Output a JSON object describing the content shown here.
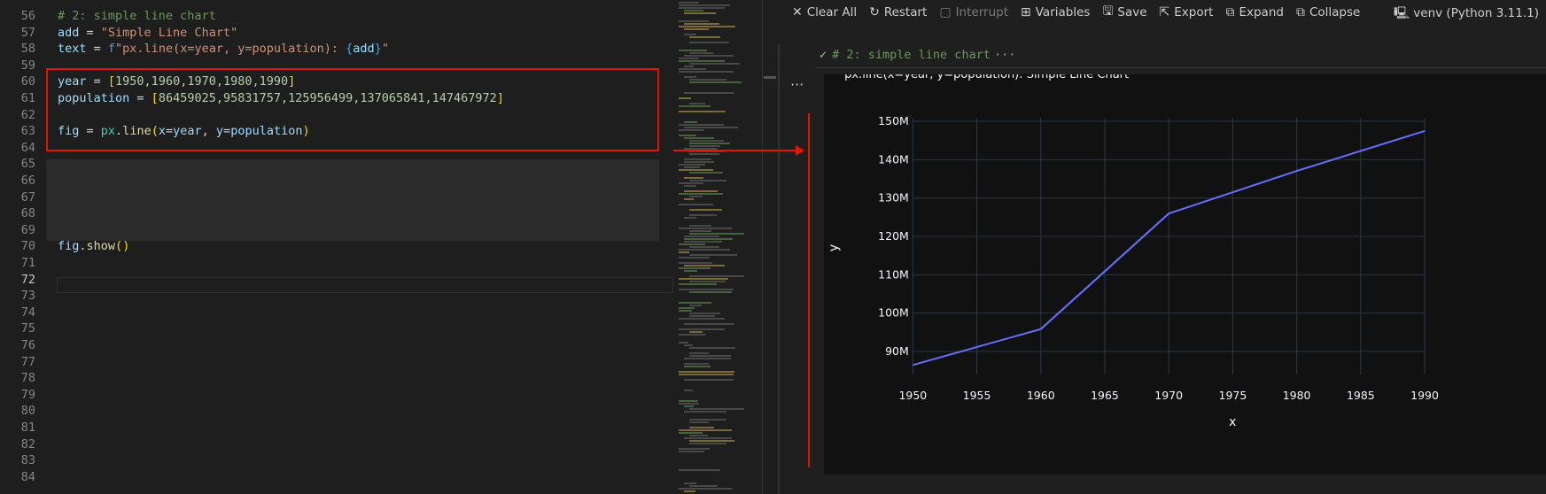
{
  "editor": {
    "lines": [
      {
        "n": "56",
        "tokens": [
          [
            "# 2: simple line chart",
            "comment"
          ]
        ]
      },
      {
        "n": "57",
        "tokens": [
          [
            "add",
            "var"
          ],
          [
            " = ",
            "op"
          ],
          [
            "\"Simple Line Chart\"",
            "str"
          ]
        ]
      },
      {
        "n": "58",
        "tokens": [
          [
            "text",
            "var"
          ],
          [
            " = ",
            "op"
          ],
          [
            "f",
            "kw"
          ],
          [
            "\"px.line(x=year, y=population): ",
            "str"
          ],
          [
            "{",
            "kw"
          ],
          [
            "add",
            "var"
          ],
          [
            "}",
            "kw"
          ],
          [
            "\"",
            "str"
          ]
        ]
      },
      {
        "n": "59",
        "tokens": []
      },
      {
        "n": "60",
        "tokens": [
          [
            "year",
            "var"
          ],
          [
            " = ",
            "op"
          ],
          [
            "[",
            "br1"
          ],
          [
            "1950,1960,1970,1980,1990",
            "num"
          ],
          [
            "]",
            "br1"
          ]
        ]
      },
      {
        "n": "61",
        "tokens": [
          [
            "population",
            "var"
          ],
          [
            " = ",
            "op"
          ],
          [
            "[",
            "br1"
          ],
          [
            "86459025,95831757,125956499,137065841,147467972",
            "num"
          ],
          [
            "]",
            "br1"
          ]
        ]
      },
      {
        "n": "62",
        "tokens": []
      },
      {
        "n": "63",
        "tokens": [
          [
            "fig",
            "var"
          ],
          [
            " = ",
            "op"
          ],
          [
            "px",
            "ns"
          ],
          [
            ".",
            "op"
          ],
          [
            "line",
            "fn"
          ],
          [
            "(",
            "br1"
          ],
          [
            "x",
            "var"
          ],
          [
            "=",
            "op"
          ],
          [
            "year",
            "var"
          ],
          [
            ", ",
            "op"
          ],
          [
            "y",
            "var"
          ],
          [
            "=",
            "op"
          ],
          [
            "population",
            "var"
          ],
          [
            ")",
            "br1"
          ]
        ]
      },
      {
        "n": "64",
        "tokens": []
      },
      {
        "n": "65",
        "tokens": []
      },
      {
        "n": "66",
        "tokens": []
      },
      {
        "n": "67",
        "tokens": []
      },
      {
        "n": "68",
        "tokens": []
      },
      {
        "n": "69",
        "tokens": []
      },
      {
        "n": "70",
        "tokens": [
          [
            "fig",
            "var"
          ],
          [
            ".",
            "op"
          ],
          [
            "show",
            "fn"
          ],
          [
            "(",
            "br1"
          ],
          [
            ")",
            "br1"
          ]
        ]
      },
      {
        "n": "71",
        "tokens": []
      },
      {
        "n": "72",
        "tokens": []
      },
      {
        "n": "73",
        "tokens": []
      },
      {
        "n": "74",
        "tokens": []
      },
      {
        "n": "75",
        "tokens": []
      },
      {
        "n": "76",
        "tokens": []
      },
      {
        "n": "77",
        "tokens": []
      },
      {
        "n": "78",
        "tokens": []
      },
      {
        "n": "79",
        "tokens": []
      },
      {
        "n": "80",
        "tokens": []
      },
      {
        "n": "81",
        "tokens": []
      },
      {
        "n": "82",
        "tokens": []
      },
      {
        "n": "83",
        "tokens": []
      },
      {
        "n": "84",
        "tokens": []
      }
    ],
    "active_line": "72"
  },
  "toolbar": {
    "clear_all": "Clear All",
    "restart": "Restart",
    "interrupt": "Interrupt",
    "variables": "Variables",
    "save": "Save",
    "export": "Export",
    "expand": "Expand",
    "collapse": "Collapse",
    "kernel": "venv (Python 3.11.1)"
  },
  "cell": {
    "header": "# 2: simple line chart",
    "more": "···",
    "ellipsis": "···"
  },
  "colors": {
    "line": "#636efa",
    "plot_bg": "#111111",
    "grid": "#283442",
    "highlight": "#e51400"
  },
  "chart_data": {
    "type": "line",
    "title": "px.line(x=year, y=population): Simple Line Chart",
    "xlabel": "x",
    "ylabel": "y",
    "x": [
      1950,
      1960,
      1970,
      1980,
      1990
    ],
    "y": [
      86459025,
      95831757,
      125956499,
      137065841,
      147467972
    ],
    "xlim": [
      1950,
      1990
    ],
    "ylim": [
      84000000,
      150000000
    ],
    "x_ticks": [
      1950,
      1955,
      1960,
      1965,
      1970,
      1975,
      1980,
      1985,
      1990
    ],
    "y_ticks": [
      90000000,
      100000000,
      110000000,
      120000000,
      130000000,
      140000000,
      150000000
    ],
    "y_tick_labels": [
      "90M",
      "100M",
      "110M",
      "120M",
      "130M",
      "140M",
      "150M"
    ],
    "grid": true
  }
}
